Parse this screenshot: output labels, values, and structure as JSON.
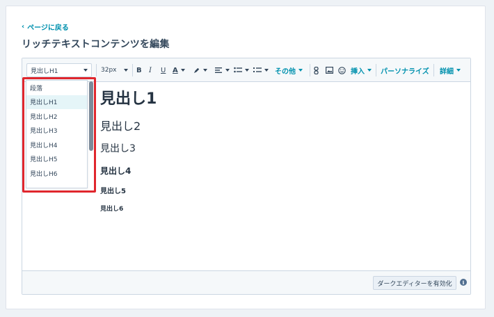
{
  "header": {
    "back_link": "ページに戻る",
    "title": "リッチテキストコンテンツを編集"
  },
  "toolbar": {
    "block_format_value": "見出しH1",
    "font_size_value": "32px",
    "bold_label": "B",
    "italic_label": "I",
    "underline_label": "U",
    "font_color_label": "A",
    "more_label": "その他",
    "insert_label": "挿入",
    "personalize_label": "パーソナライズ",
    "details_label": "詳細",
    "icons": [
      "highlight-pen-icon",
      "align-icon",
      "bulleted-list-icon",
      "numbered-list-icon",
      "link-icon",
      "image-icon",
      "emoji-icon"
    ]
  },
  "dropdown": {
    "options": [
      "段落",
      "見出しH1",
      "見出しH2",
      "見出しH3",
      "見出しH4",
      "見出しH5",
      "見出しH6"
    ],
    "selected": "見出しH1"
  },
  "content": {
    "h1": "見出し1",
    "h2": "見出し2",
    "h3": "見出し3",
    "h4": "見出し4",
    "h5": "見出し5",
    "h6": "見出し6"
  },
  "footer": {
    "dark_editor_button": "ダークエディターを有効化",
    "info_icon": "i"
  },
  "colors": {
    "accent": "#0091ae",
    "highlight": "#e0262d",
    "text": "#33475b"
  }
}
